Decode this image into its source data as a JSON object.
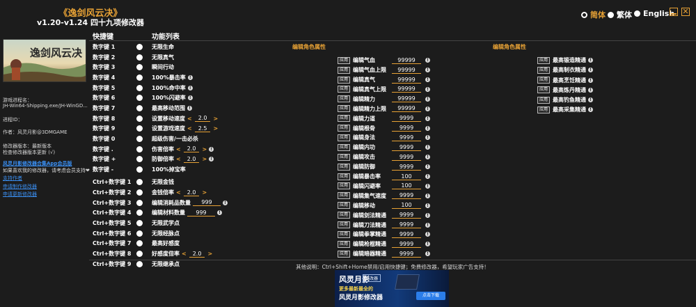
{
  "header": {
    "title": "《逸剑风云决》",
    "subtitle": "v1.20-v1.24 四十九项修改器",
    "languages": [
      "简体",
      "繁体",
      "English"
    ]
  },
  "left": {
    "process_label": "游戏进程名：",
    "process_value": "JH-Win64-Shipping.exe/JH-WinGD...",
    "pid_label": "进程ID：",
    "author": "作者：风灵月影@3DMGAME",
    "version_line1": "修改器版本：最新版本",
    "version_line2": "检查修改器版本更新 (√)",
    "app_link": "风灵月影修改器合集App会员版",
    "support_text": "如果喜欢我的修改器，请考虑会员支持",
    "link_support": "支持作者",
    "link_request": "申请制作修改器",
    "link_update": "申请更新修改器"
  },
  "columns": {
    "hotkey": "快捷键",
    "function": "功能列表"
  },
  "sections": {
    "mid_title": "编辑角色属性",
    "right_title": "编辑角色属性"
  },
  "apply_label": "应用",
  "cheats": [
    {
      "key": "数字键 1",
      "name": "无限生命"
    },
    {
      "key": "数字键 2",
      "name": "无限真气"
    },
    {
      "key": "数字键 3",
      "name": "瞬间行动"
    },
    {
      "key": "数字键 4",
      "name": "100%暴击率"
    },
    {
      "key": "数字键 5",
      "name": "100%命中率"
    },
    {
      "key": "数字键 6",
      "name": "100%闪避率"
    },
    {
      "key": "数字键 7",
      "name": "最高移动范围"
    },
    {
      "key": "数字键 8",
      "name": "设置移动速度",
      "value": "2.0"
    },
    {
      "key": "数字键 9",
      "name": "设置游戏速度",
      "value": "2.5"
    },
    {
      "key": "数字键 0",
      "name": "超级伤害/一击必杀"
    },
    {
      "key": "数字键 .",
      "name": "伤害倍率",
      "value": "2.0"
    },
    {
      "key": "数字键 +",
      "name": "防御倍率",
      "value": "2.0"
    },
    {
      "key": "数字键 -",
      "name": "100%掉宝率"
    },
    {
      "key": "Ctrl+数字键 1",
      "name": "无限金钱"
    },
    {
      "key": "Ctrl+数字键 2",
      "name": "金钱倍率",
      "value": "2.0"
    },
    {
      "key": "Ctrl+数字键 3",
      "name": "编辑消耗品数量",
      "input": "999"
    },
    {
      "key": "Ctrl+数字键 4",
      "name": "编辑材料数量",
      "input": "999"
    },
    {
      "key": "Ctrl+数字键 5",
      "name": "无限武学点"
    },
    {
      "key": "Ctrl+数字键 6",
      "name": "无限经脉点"
    },
    {
      "key": "Ctrl+数字键 7",
      "name": "最高好感度"
    },
    {
      "key": "Ctrl+数字键 8",
      "name": "好感度倍率",
      "value": "2.0"
    },
    {
      "key": "Ctrl+数字键 9",
      "name": "无限继承点"
    }
  ],
  "edit_attrs": [
    {
      "name": "编辑气血",
      "value": "99999"
    },
    {
      "name": "编辑气血上限",
      "value": "99999"
    },
    {
      "name": "编辑真气",
      "value": "99999"
    },
    {
      "name": "编辑真气上限",
      "value": "99999"
    },
    {
      "name": "编辑精力",
      "value": "99999"
    },
    {
      "name": "编辑精力上限",
      "value": "99999"
    },
    {
      "name": "编辑力道",
      "value": "9999"
    },
    {
      "name": "编辑根骨",
      "value": "9999"
    },
    {
      "name": "编辑身法",
      "value": "9999"
    },
    {
      "name": "编辑内功",
      "value": "9999"
    },
    {
      "name": "编辑攻击",
      "value": "9999"
    },
    {
      "name": "编辑防御",
      "value": "9999"
    },
    {
      "name": "编辑暴击率",
      "value": "100"
    },
    {
      "name": "编辑闪避率",
      "value": "100"
    },
    {
      "name": "编辑集气速度",
      "value": "9999"
    },
    {
      "name": "编辑移动",
      "value": "100"
    },
    {
      "name": "编辑剑法精通",
      "value": "9999"
    },
    {
      "name": "编辑刀法精通",
      "value": "9999"
    },
    {
      "name": "编辑拳掌精通",
      "value": "9999"
    },
    {
      "name": "编辑枪棍精通",
      "value": "9999"
    },
    {
      "name": "编辑暗器精通",
      "value": "9999"
    }
  ],
  "mastery": [
    {
      "name": "最高锻造精通"
    },
    {
      "name": "最高制衣精通"
    },
    {
      "name": "最高烹饪精通"
    },
    {
      "name": "最高炼丹精通"
    },
    {
      "name": "最高钓鱼精通"
    },
    {
      "name": "最高采集精通"
    }
  ],
  "footer_note": "其他说明：Ctrl+Shift+Home禁用/启用快捷键；免费修改器，希望玩家广告支持！",
  "ad": {
    "logo": "风灵月影",
    "tag": "修改器",
    "line1": "更多最新最全的",
    "line2": "风灵月影修改器",
    "download": "点击下载"
  },
  "colors": {
    "accent": "#e8a235",
    "background": "#1c1c1c",
    "link": "#3a8ef0"
  }
}
